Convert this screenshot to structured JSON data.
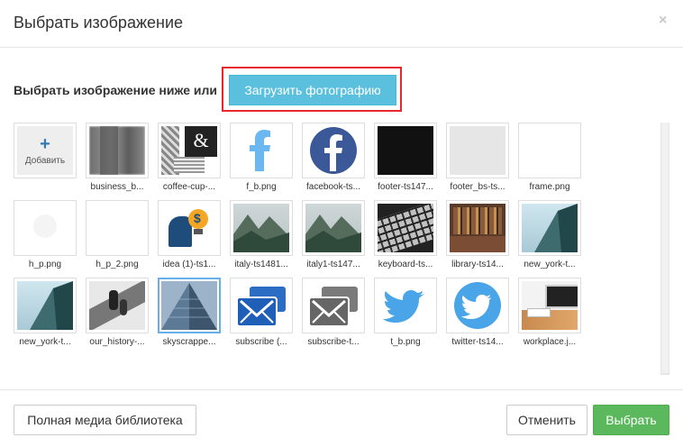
{
  "dialog": {
    "title": "Выбрать изображение",
    "close_glyph": "×"
  },
  "upload": {
    "prompt": "Выбрать изображение ниже или",
    "button_label": "Загрузить фотографию",
    "highlight_color": "#e8262c",
    "button_color": "#5bc0de"
  },
  "gallery": {
    "add_label": "Добавить",
    "add_glyph": "+",
    "items": [
      {
        "label": "business_b...",
        "kind": "blur-photo"
      },
      {
        "label": "coffee-cup-...",
        "kind": "coffee"
      },
      {
        "label": "f_b.png",
        "kind": "f-letter"
      },
      {
        "label": "facebook-ts...",
        "kind": "facebook-circle"
      },
      {
        "label": "footer-ts147...",
        "kind": "black"
      },
      {
        "label": "footer_bs-ts...",
        "kind": "lightgray"
      },
      {
        "label": "frame.png",
        "kind": "white"
      },
      {
        "label": "h_p.png",
        "kind": "faint"
      },
      {
        "label": "h_p_2.png",
        "kind": "white"
      },
      {
        "label": "idea (1)-ts1...",
        "kind": "idea"
      },
      {
        "label": "italy-ts1481...",
        "kind": "mountain"
      },
      {
        "label": "italy1-ts147...",
        "kind": "mountain"
      },
      {
        "label": "keyboard-ts...",
        "kind": "keyboard"
      },
      {
        "label": "library-ts14...",
        "kind": "library"
      },
      {
        "label": "new_york-t...",
        "kind": "building"
      },
      {
        "label": "new_york-t...",
        "kind": "building"
      },
      {
        "label": "our_history-...",
        "kind": "history"
      },
      {
        "label": "skyscrappe...",
        "kind": "skyscraper",
        "selected": true
      },
      {
        "label": "subscribe (...",
        "kind": "mail-blue"
      },
      {
        "label": "subscribe-t...",
        "kind": "mail-gray"
      },
      {
        "label": "t_b.png",
        "kind": "twitter-bird"
      },
      {
        "label": "twitter-ts14...",
        "kind": "twitter-circle"
      },
      {
        "label": "workplace.j...",
        "kind": "workplace"
      }
    ]
  },
  "footer": {
    "library_button": "Полная медиа библиотека",
    "cancel_button": "Отменить",
    "select_button": "Выбрать",
    "select_color": "#5cb85c"
  }
}
